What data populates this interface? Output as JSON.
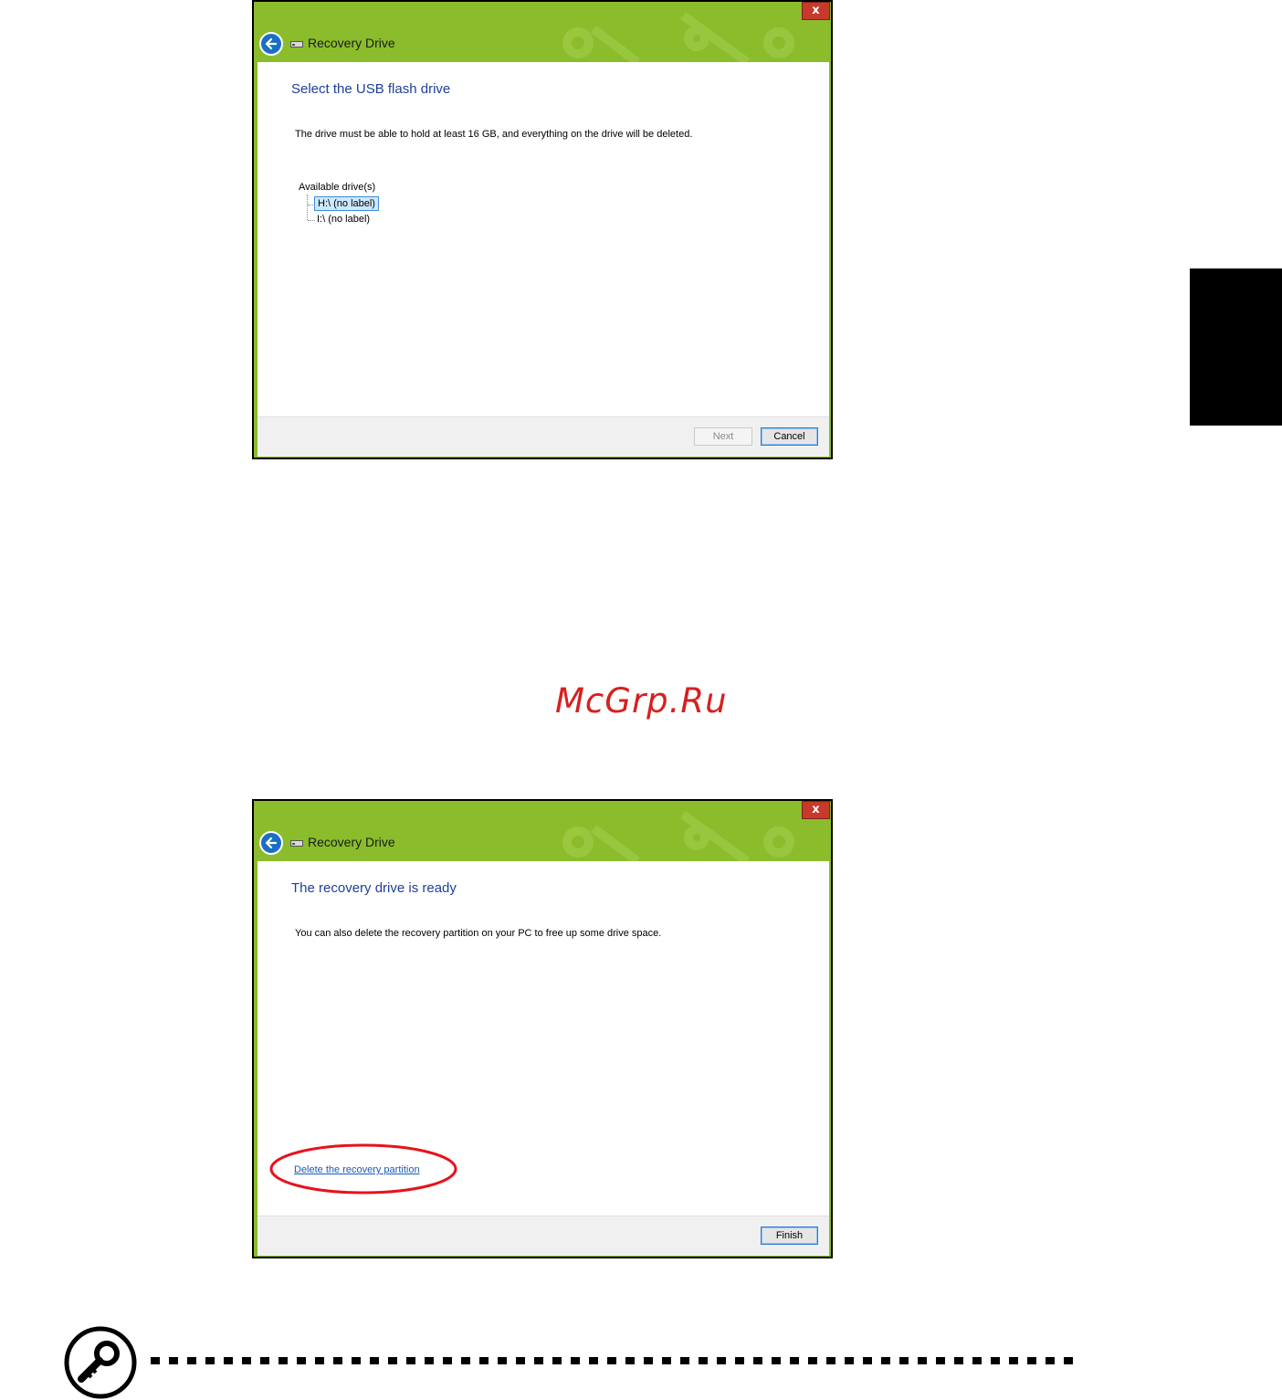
{
  "watermark": "McGrp.Ru",
  "dialog1": {
    "title": "Recovery Drive",
    "close_label": "x",
    "heading": "Select the USB flash drive",
    "description": "The drive must be able to hold at least 16 GB, and everything on the drive will be deleted.",
    "tree_root": "Available drive(s)",
    "drives": [
      "H:\\ (no label)",
      "I:\\ (no label)"
    ],
    "selected_drive": "H:\\ (no label)",
    "next_label": "Next",
    "cancel_label": "Cancel"
  },
  "dialog2": {
    "title": "Recovery Drive",
    "close_label": "x",
    "heading": "The recovery drive is ready",
    "description": "You can also delete the recovery partition on your PC to free up some drive space.",
    "link_label": "Delete the recovery partition",
    "finish_label": "Finish"
  },
  "colors": {
    "titlebar_green": "#8bbc2c",
    "heading_blue": "#1e3f9a",
    "close_red": "#c6392b",
    "highlight_ellipse": "#e8121b",
    "watermark_red": "#d62020"
  },
  "icons": [
    "back-arrow-icon",
    "drive-icon",
    "close-icon",
    "key-note-icon"
  ]
}
